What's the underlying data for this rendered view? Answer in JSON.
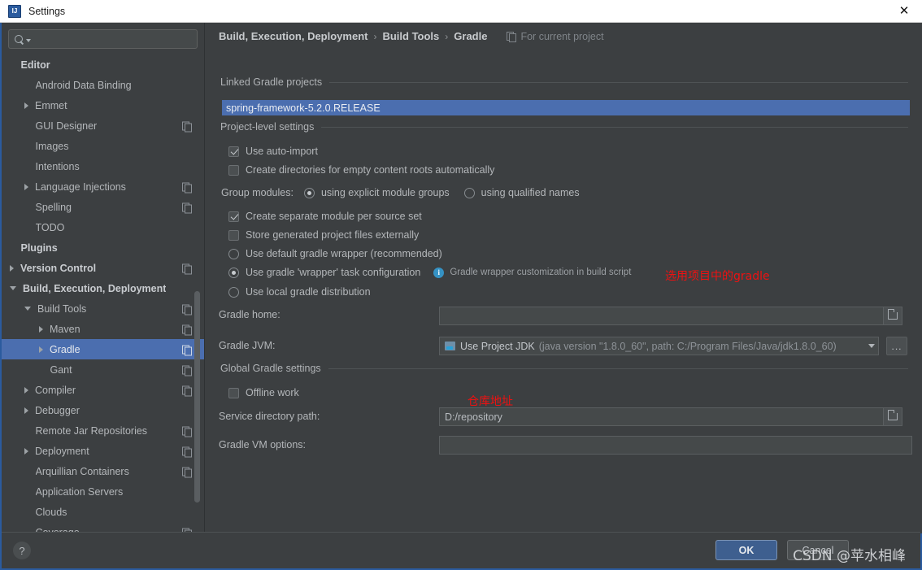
{
  "window": {
    "title": "Settings",
    "logo_icon": "intellij-idea-logo",
    "close_icon": "close-icon"
  },
  "sidebar": {
    "search": {
      "placeholder": "",
      "value": "",
      "icon": "search-icon",
      "caret_icon": "chevron-down-icon"
    },
    "items": [
      {
        "label": "Editor",
        "indent": 0,
        "bold": true,
        "arrow": "none",
        "copy": false,
        "selected": false
      },
      {
        "label": "Android Data Binding",
        "indent": 1,
        "bold": false,
        "arrow": "none",
        "copy": false,
        "selected": false
      },
      {
        "label": "Emmet",
        "indent": 1,
        "bold": false,
        "arrow": "right",
        "copy": false,
        "selected": false
      },
      {
        "label": "GUI Designer",
        "indent": 1,
        "bold": false,
        "arrow": "none",
        "copy": true,
        "selected": false
      },
      {
        "label": "Images",
        "indent": 1,
        "bold": false,
        "arrow": "none",
        "copy": false,
        "selected": false
      },
      {
        "label": "Intentions",
        "indent": 1,
        "bold": false,
        "arrow": "none",
        "copy": false,
        "selected": false
      },
      {
        "label": "Language Injections",
        "indent": 1,
        "bold": false,
        "arrow": "right",
        "copy": true,
        "selected": false
      },
      {
        "label": "Spelling",
        "indent": 1,
        "bold": false,
        "arrow": "none",
        "copy": true,
        "selected": false
      },
      {
        "label": "TODO",
        "indent": 1,
        "bold": false,
        "arrow": "none",
        "copy": false,
        "selected": false
      },
      {
        "label": "Plugins",
        "indent": 0,
        "bold": true,
        "arrow": "none",
        "copy": false,
        "selected": false
      },
      {
        "label": "Version Control",
        "indent": 0,
        "bold": true,
        "arrow": "right",
        "copy": true,
        "selected": false
      },
      {
        "label": "Build, Execution, Deployment",
        "indent": 0,
        "bold": true,
        "arrow": "down",
        "copy": false,
        "selected": false
      },
      {
        "label": "Build Tools",
        "indent": 1,
        "bold": false,
        "arrow": "down",
        "copy": true,
        "selected": false
      },
      {
        "label": "Maven",
        "indent": 2,
        "bold": false,
        "arrow": "right",
        "copy": true,
        "selected": false
      },
      {
        "label": "Gradle",
        "indent": 2,
        "bold": false,
        "arrow": "right",
        "copy": true,
        "selected": true
      },
      {
        "label": "Gant",
        "indent": 2,
        "bold": false,
        "arrow": "none",
        "copy": true,
        "selected": false
      },
      {
        "label": "Compiler",
        "indent": 1,
        "bold": false,
        "arrow": "right",
        "copy": true,
        "selected": false
      },
      {
        "label": "Debugger",
        "indent": 1,
        "bold": false,
        "arrow": "right",
        "copy": false,
        "selected": false
      },
      {
        "label": "Remote Jar Repositories",
        "indent": 1,
        "bold": false,
        "arrow": "none",
        "copy": true,
        "selected": false
      },
      {
        "label": "Deployment",
        "indent": 1,
        "bold": false,
        "arrow": "right",
        "copy": true,
        "selected": false
      },
      {
        "label": "Arquillian Containers",
        "indent": 1,
        "bold": false,
        "arrow": "none",
        "copy": true,
        "selected": false
      },
      {
        "label": "Application Servers",
        "indent": 1,
        "bold": false,
        "arrow": "none",
        "copy": false,
        "selected": false
      },
      {
        "label": "Clouds",
        "indent": 1,
        "bold": false,
        "arrow": "none",
        "copy": false,
        "selected": false
      },
      {
        "label": "Coverage",
        "indent": 1,
        "bold": false,
        "arrow": "none",
        "copy": true,
        "selected": false
      }
    ]
  },
  "breadcrumb": {
    "part1": "Build, Execution, Deployment",
    "part2": "Build Tools",
    "part3": "Gradle",
    "separator": "›",
    "scope_note": "For current project",
    "scope_icon": "copy-icon"
  },
  "sections": {
    "linked_projects": {
      "header": "Linked Gradle projects",
      "selected_project": "spring-framework-5.2.0.RELEASE"
    },
    "project_level": {
      "header": "Project-level settings",
      "use_auto_import": {
        "label": "Use auto-import",
        "checked": true
      },
      "create_directories": {
        "label": "Create directories for empty content roots automatically",
        "checked": false
      },
      "group_modules": {
        "label": "Group modules:",
        "option1": "using explicit module groups",
        "option2": "using qualified names",
        "selected": "using explicit module groups"
      },
      "separate_module": {
        "label": "Create separate module per source set",
        "checked": true
      },
      "store_externally": {
        "label": "Store generated project files externally",
        "checked": false
      },
      "gradle_distribution": {
        "option_default": "Use default gradle wrapper (recommended)",
        "option_wrapper_task": "Use gradle 'wrapper' task configuration",
        "option_local": "Use local gradle distribution",
        "selected": "Use gradle 'wrapper' task configuration",
        "hint": "Gradle wrapper customization in build script",
        "hint_icon": "info-icon"
      },
      "gradle_home": {
        "label": "Gradle home:",
        "value": "",
        "browse_icon": "folder-icon"
      },
      "gradle_jvm": {
        "label": "Gradle JVM:",
        "value": "Use Project JDK",
        "detail": "(java version \"1.8.0_60\", path: C:/Program Files/Java/jdk1.8.0_60)",
        "icon": "jdk-icon",
        "caret_icon": "chevron-down-icon",
        "more_button": "..."
      }
    },
    "global_settings": {
      "header": "Global Gradle settings",
      "offline_work": {
        "label": "Offline work",
        "checked": false
      },
      "service_directory": {
        "label": "Service directory path:",
        "value": "D:/repository",
        "browse_icon": "folder-icon"
      },
      "vm_options": {
        "label": "Gradle VM options:",
        "value": ""
      }
    }
  },
  "annotations": [
    {
      "text": "选用项目中的gradle",
      "color": "#ee1111"
    },
    {
      "text": "仓库地址",
      "color": "#ee1111"
    }
  ],
  "footer": {
    "help_label": "?",
    "ok_label": "OK",
    "cancel_label": "Cancel",
    "watermark": "CSDN @苹水相峰"
  }
}
